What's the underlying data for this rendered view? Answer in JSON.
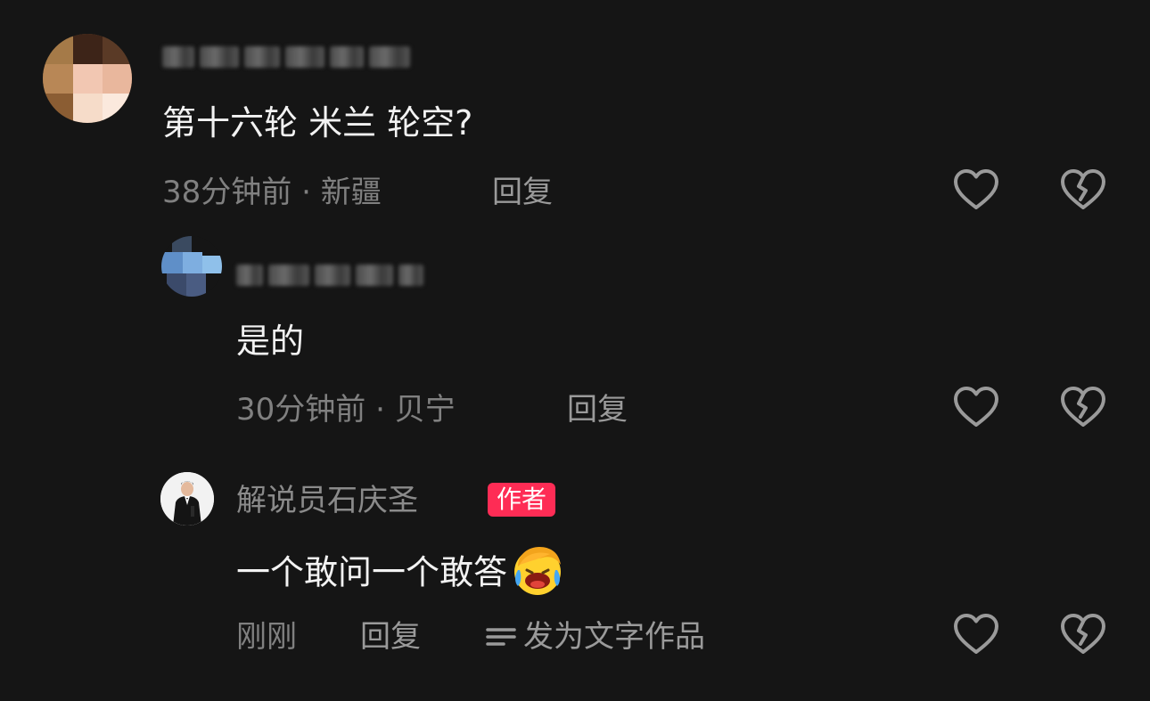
{
  "comments": [
    {
      "username": "",
      "text": "第十六轮 米兰 轮空?",
      "time": "38分钟前",
      "location": "新疆",
      "reply_label": "回复"
    },
    {
      "username": "",
      "text": "是的",
      "time": "30分钟前",
      "location": "贝宁",
      "reply_label": "回复"
    },
    {
      "username": "解说员石庆圣",
      "badge": "作者",
      "text": "一个敢问一个敢答",
      "emoji": "face-palm-laughing-emoji",
      "time": "刚刚",
      "reply_label": "回复",
      "text_work_label": "发为文字作品"
    }
  ],
  "meta_separator": "·",
  "icons": {
    "like": "heart-outline-icon",
    "dislike": "broken-heart-icon",
    "text_work": "lines-icon"
  },
  "colors": {
    "background": "#151515",
    "badge": "#fe2c55",
    "secondary_text": "#808080"
  }
}
